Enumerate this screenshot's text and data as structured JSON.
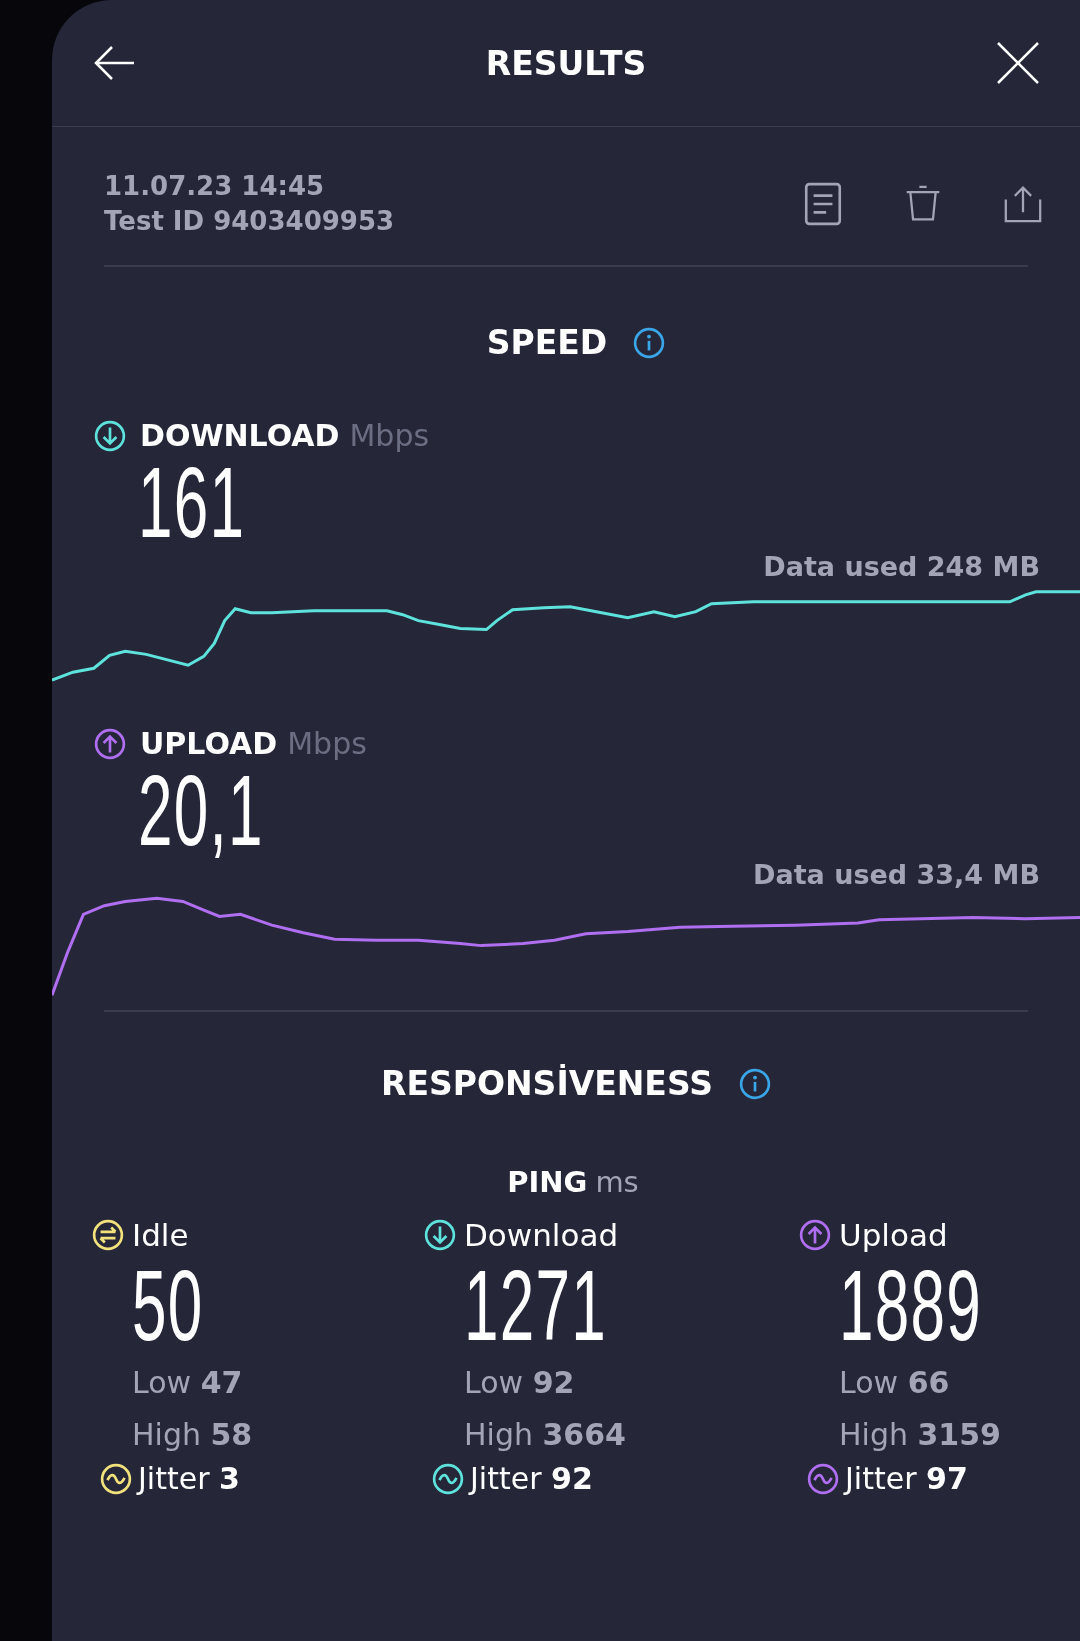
{
  "header": {
    "title": "RESULTS"
  },
  "test": {
    "date": "11.07.23 14:45",
    "test_id": "Test ID 9403409953"
  },
  "speed": {
    "title": "SPEED",
    "metrics": [
      {
        "kind": "download",
        "label": "DOWNLOAD",
        "unit": "Mbps",
        "value": "161",
        "data_used": "Data used 248 MB",
        "color": "#5ee3dc"
      },
      {
        "kind": "upload",
        "label": "UPLOAD",
        "unit": "Mbps",
        "value": "20,1",
        "data_used": "Data used 33,4 MB",
        "color": "#b06ef0"
      }
    ]
  },
  "responsiveness": {
    "title": "RESPONSİVENESS",
    "ping_label": "PING",
    "ping_unit": "ms",
    "columns": [
      {
        "kind": "idle",
        "label": "Idle",
        "value": "50",
        "low_label": "Low",
        "low": "47",
        "high_label": "High",
        "high": "58",
        "jitter_label": "Jitter",
        "jitter": "3",
        "color": "#f2e27c"
      },
      {
        "kind": "download",
        "label": "Download",
        "value": "1271",
        "low_label": "Low",
        "low": "92",
        "high_label": "High",
        "high": "3664",
        "jitter_label": "Jitter",
        "jitter": "92",
        "color": "#5ee3dc"
      },
      {
        "kind": "upload",
        "label": "Upload",
        "value": "1889",
        "low_label": "Low",
        "low": "66",
        "high_label": "High",
        "high": "3159",
        "jitter_label": "Jitter",
        "jitter": "97",
        "color": "#b06ef0"
      }
    ]
  }
}
